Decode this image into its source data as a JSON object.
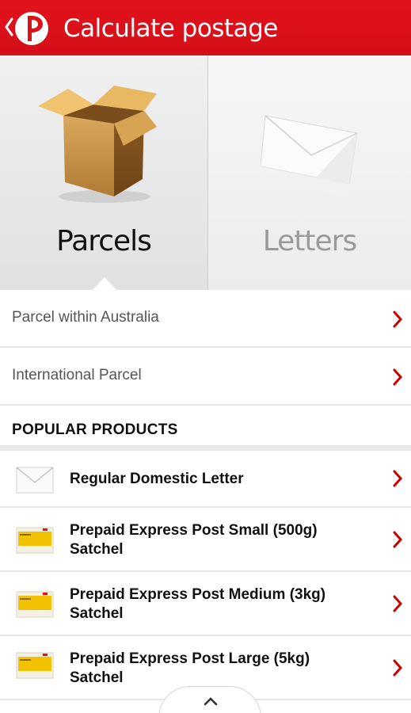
{
  "header": {
    "title": "Calculate postage",
    "back_icon": "chevron-left-icon",
    "logo_icon": "australia-post-logo",
    "background": "#dd1219"
  },
  "categories": [
    {
      "label": "Parcels",
      "icon": "parcel-box-icon",
      "selected": true
    },
    {
      "label": "Letters",
      "icon": "envelope-icon",
      "selected": false
    }
  ],
  "options": [
    {
      "label": "Parcel within Australia"
    },
    {
      "label": "International Parcel"
    }
  ],
  "popular": {
    "title": "POPULAR PRODUCTS",
    "items": [
      {
        "line1": "Regular Domestic Letter",
        "line2": "",
        "icon": "envelope-icon"
      },
      {
        "line1": "Prepaid Express Post Small (500g)",
        "line2": "Satchel",
        "icon": "express-post-satchel-icon"
      },
      {
        "line1": "Prepaid Express Post Medium (3kg)",
        "line2": "Satchel",
        "icon": "express-post-satchel-icon"
      },
      {
        "line1": "Prepaid Express Post Large (5kg)",
        "line2": "Satchel",
        "icon": "express-post-satchel-icon"
      }
    ]
  },
  "accent": "#cc0000",
  "drawer_handle_icon": "chevron-up-icon"
}
